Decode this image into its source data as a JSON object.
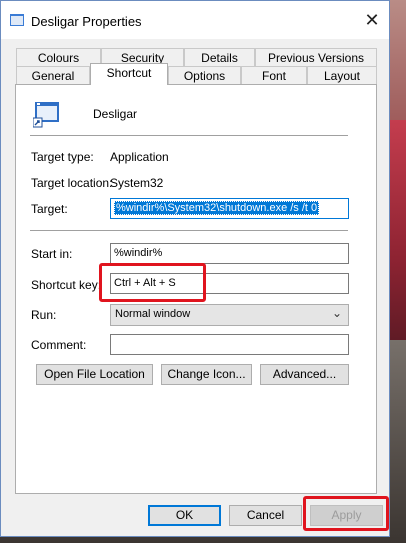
{
  "window": {
    "title": "Desligar Properties"
  },
  "tabs_row1": [
    {
      "label": "Colours"
    },
    {
      "label": "Security"
    },
    {
      "label": "Details"
    },
    {
      "label": "Previous Versions"
    }
  ],
  "tabs_row2": [
    {
      "label": "General"
    },
    {
      "label": "Shortcut"
    },
    {
      "label": "Options"
    },
    {
      "label": "Font"
    },
    {
      "label": "Layout"
    }
  ],
  "shortcut": {
    "name": "Desligar",
    "target_type_label": "Target type:",
    "target_type_value": "Application",
    "target_location_label": "Target location:",
    "target_location_value": "System32",
    "target_label": "Target:",
    "target_value": "%windir%\\System32\\shutdown.exe /s /t 0",
    "start_in_label": "Start in:",
    "start_in_value": "%windir%",
    "shortcut_key_label": "Shortcut key:",
    "shortcut_key_value": "Ctrl + Alt + S",
    "run_label": "Run:",
    "run_value": "Normal window",
    "comment_label": "Comment:",
    "comment_value": ""
  },
  "buttons": {
    "open_file_location": "Open File Location",
    "change_icon": "Change Icon...",
    "advanced": "Advanced...",
    "ok": "OK",
    "cancel": "Cancel",
    "apply": "Apply"
  },
  "colors": {
    "highlight": "#e0141e",
    "selection": "#0078d7"
  }
}
